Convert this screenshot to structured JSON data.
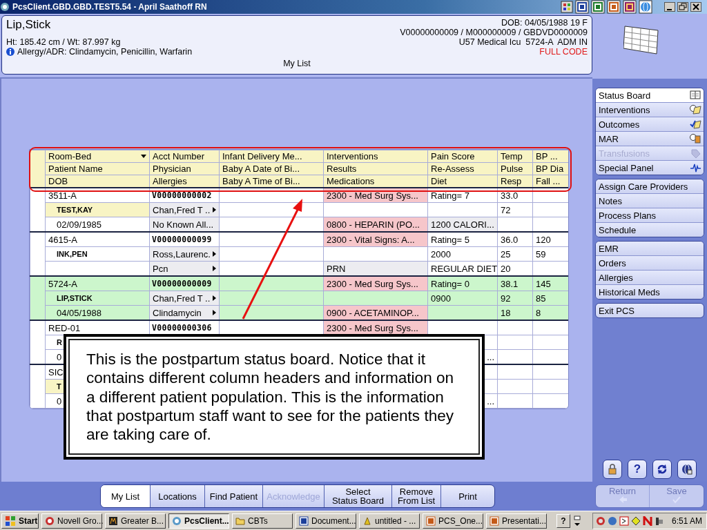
{
  "window": {
    "title": "PcsClient.GBD.GBD.TEST5.54 - April Saathoff RN"
  },
  "patient_header": {
    "name": "Lip,Stick",
    "dob": "DOB: 04/05/1988 19 F",
    "ids": "V00000000009 / M000000009 / GBDVD0000009",
    "height_weight": "Ht: 185.42 cm / Wt: 87.997 kg",
    "location": "U57 Medical Icu  5724-A  ADM IN",
    "allergy": "Allergy/ADR: Clindamycin, Penicillin, Warfarin",
    "code_status": "FULL CODE",
    "list_name": "My List"
  },
  "table": {
    "columns": [
      [
        "Room-Bed",
        "Patient Name",
        "DOB"
      ],
      [
        "Acct Number",
        "Physician",
        "Allergies"
      ],
      [
        "Infant Delivery Me...",
        "Baby A Date of Bi...",
        "Baby A Time of Bi..."
      ],
      [
        "Interventions",
        "Results",
        "Medications"
      ],
      [
        "Pain Score",
        "Re-Assess",
        "Diet"
      ],
      [
        "Temp",
        "Pulse",
        "Resp"
      ],
      [
        "BP ...",
        "BP Dia",
        "Fall ..."
      ]
    ],
    "patients": [
      {
        "selected": false,
        "lines": [
          {
            "column_1": "3511-A",
            "column_2": {
              "text": "V00000000002",
              "kind": "account"
            },
            "column_4": {
              "text": "2300 - Med Surg Sys...",
              "kind": "alert"
            },
            "column_5": "Rating= 7",
            "column_6": "33.0"
          },
          {
            "column_1": {
              "text": "TEST,KAY",
              "kind": "flagged-name"
            },
            "column_2": {
              "text": "Chan,Fred T ..",
              "kind": "link"
            },
            "column_6": "72"
          },
          {
            "column_1": {
              "text": "02/09/1985",
              "kind": "dob"
            },
            "column_2": {
              "text": "No Known All...",
              "kind": "shaded"
            },
            "column_4": {
              "text": "0800 - HEPARIN (PO...",
              "kind": "alert"
            },
            "column_5": {
              "text": "1200 CALORI...",
              "kind": "shaded"
            }
          }
        ]
      },
      {
        "selected": false,
        "lines": [
          {
            "column_1": "4615-A",
            "column_2": {
              "text": "V00000000099",
              "kind": "account"
            },
            "column_4": {
              "text": "2300 - Vital Signs: A...",
              "kind": "alert"
            },
            "column_5": "Rating= 5",
            "column_6": "36.0",
            "column_7": "120"
          },
          {
            "column_1": {
              "text": "INK,PEN",
              "kind": "name"
            },
            "column_2": {
              "text": "Ross,Laurenc.",
              "kind": "link"
            },
            "column_5": "2000",
            "column_6": "25",
            "column_7": "59"
          },
          {
            "column_2": {
              "text": "Pcn",
              "kind": "link"
            },
            "column_4": {
              "text": "PRN",
              "kind": "shaded"
            },
            "column_5": "REGULAR DIET",
            "column_6": "20"
          }
        ]
      },
      {
        "selected": true,
        "lines": [
          {
            "column_1": "5724-A",
            "column_2": {
              "text": "V00000000009",
              "kind": "account"
            },
            "column_4": {
              "text": "2300 - Med Surg Sys...",
              "kind": "alert"
            },
            "column_5": "Rating= 0",
            "column_6": "38.1",
            "column_7": "145"
          },
          {
            "column_1": {
              "text": "LIP,STICK",
              "kind": "name"
            },
            "column_2": {
              "text": "Chan,Fred T ..",
              "kind": "link"
            },
            "column_5": "0900",
            "column_6": "92",
            "column_7": "85"
          },
          {
            "column_1": {
              "text": "04/05/1988",
              "kind": "dob"
            },
            "column_2": {
              "text": "Clindamycin",
              "kind": "link"
            },
            "column_4": {
              "text": "0900 - ACETAMINOP...",
              "kind": "alert"
            },
            "column_6": "18",
            "column_7": "8"
          }
        ]
      },
      {
        "selected": false,
        "lines": [
          {
            "column_1": "RED-01",
            "column_2": {
              "text": "V00000000306",
              "kind": "account"
            },
            "column_4": {
              "text": "2300 - Med Surg Sys...",
              "kind": "alert"
            }
          },
          {
            "column_1": {
              "text": "R",
              "kind": "name"
            }
          },
          {
            "column_1": {
              "text": "0",
              "kind": "dob"
            },
            "column_5": {
              "text": "...",
              "kind": "trail"
            }
          }
        ]
      },
      {
        "selected": false,
        "lines": [
          {
            "column_1": "SIC"
          },
          {
            "column_1": {
              "text": "T",
              "kind": "flagged-name"
            }
          },
          {
            "column_1": {
              "text": "0",
              "kind": "dob"
            },
            "column_5": {
              "text": "...",
              "kind": "trail"
            }
          }
        ]
      }
    ]
  },
  "callout": {
    "text": "This is the postpartum status board. Notice that it contains different column headers and information on a different patient population. This is the information that postpartum staff want to see for the patients they are taking care of."
  },
  "sidebar": {
    "groups": [
      [
        {
          "label": "Status Board",
          "selected": true,
          "disabled": false
        },
        {
          "label": "Interventions",
          "selected": false,
          "disabled": false
        },
        {
          "label": "Outcomes",
          "selected": false,
          "disabled": false
        },
        {
          "label": "MAR",
          "selected": false,
          "disabled": false
        },
        {
          "label": "Transfusions",
          "selected": false,
          "disabled": true
        },
        {
          "label": "Special Panel",
          "selected": false,
          "disabled": false
        }
      ],
      [
        {
          "label": "Assign Care Providers",
          "selected": false,
          "disabled": false
        },
        {
          "label": "Notes",
          "selected": false,
          "disabled": false
        },
        {
          "label": "Process Plans",
          "selected": false,
          "disabled": false
        },
        {
          "label": "Schedule",
          "selected": false,
          "disabled": false
        }
      ],
      [
        {
          "label": "EMR",
          "selected": false,
          "disabled": false
        },
        {
          "label": "Orders",
          "selected": false,
          "disabled": false
        },
        {
          "label": "Allergies",
          "selected": false,
          "disabled": false
        },
        {
          "label": "Historical Meds",
          "selected": false,
          "disabled": false
        }
      ],
      [
        {
          "label": "Exit PCS",
          "selected": false,
          "disabled": false
        }
      ]
    ],
    "help": "?",
    "actions": [
      {
        "label": "Return",
        "disabled": true
      },
      {
        "label": "Save",
        "disabled": true
      }
    ]
  },
  "bottom_tabs": [
    {
      "label": "My List",
      "selected": true,
      "disabled": false
    },
    {
      "label": "Locations",
      "selected": false,
      "disabled": false
    },
    {
      "label": "Find Patient",
      "selected": false,
      "disabled": false
    },
    {
      "label": "Acknowledge",
      "selected": false,
      "disabled": true
    },
    {
      "label": "Select\nStatus Board",
      "selected": false,
      "disabled": false
    },
    {
      "label": "Remove\nFrom List",
      "selected": false,
      "disabled": false
    },
    {
      "label": "Print",
      "selected": false,
      "disabled": false
    }
  ],
  "taskbar": {
    "start": "Start",
    "items": [
      {
        "label": "Novell Gro...",
        "selected": false
      },
      {
        "label": "Greater B...",
        "selected": false
      },
      {
        "label": "PcsClient...",
        "selected": true
      },
      {
        "label": "CBTs",
        "selected": false
      },
      {
        "label": "Document...",
        "selected": false
      },
      {
        "label": "untitled - ...",
        "selected": false
      },
      {
        "label": "PCS_One...",
        "selected": false
      },
      {
        "label": "Presentati...",
        "selected": false
      }
    ],
    "help": "?",
    "clock": "6:51 AM"
  }
}
